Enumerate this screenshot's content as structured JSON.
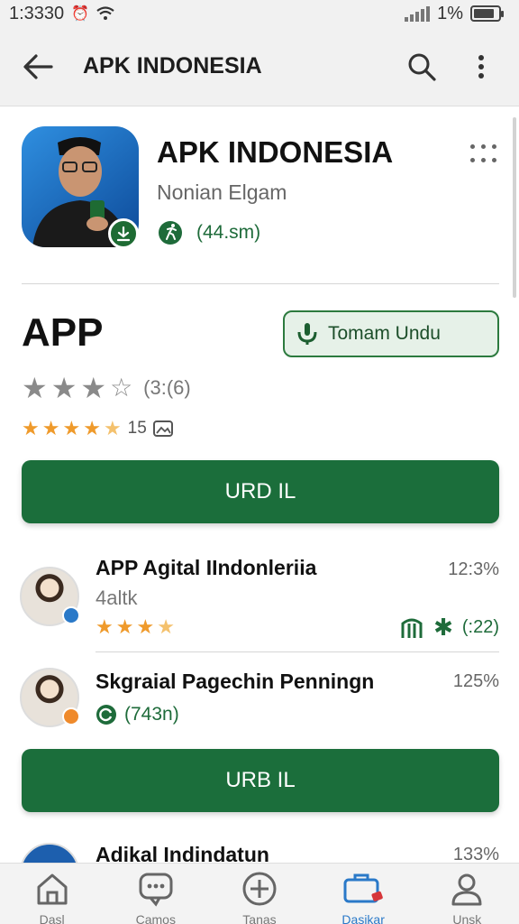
{
  "status_bar": {
    "time": "1:3330",
    "battery": "1%",
    "battery_level": 0.85
  },
  "app_bar": {
    "title": "APK INDONESIA"
  },
  "header": {
    "title": "APK INDONESIA",
    "subtitle": "Nonian Elgam",
    "meta": "(44.sm)"
  },
  "app_section": {
    "heading": "APP",
    "download_label": "Tomam Undu",
    "rating_count": "(3:(6)",
    "rating_small": "15",
    "gray_stars": 3.5,
    "orange_stars": 4.5
  },
  "buttons": {
    "primary_1": "URD IL",
    "primary_2": "URB IL"
  },
  "items": [
    {
      "title": "APP Agital IIndonleriia",
      "percent": "12:3%",
      "sub": "4altk",
      "stars": 3.5,
      "meta": "(:22)"
    },
    {
      "title": "Skgraial Pagechin Penningn",
      "percent": "125%",
      "sub": "(743n)"
    },
    {
      "title": "Adikal Indindatun",
      "percent": "133%"
    }
  ],
  "bottom_nav": [
    {
      "label": "Dasl",
      "icon": "home-icon"
    },
    {
      "label": "Camos",
      "icon": "chat-icon"
    },
    {
      "label": "Tanas",
      "icon": "plus-circle-icon"
    },
    {
      "label": "Dasikar",
      "icon": "briefcase-icon",
      "active": true
    },
    {
      "label": "Unsk",
      "icon": "user-icon"
    }
  ],
  "colors": {
    "primary_green": "#1b6e3b",
    "accent_orange": "#ef9a2b",
    "active_blue": "#2a79c8"
  }
}
